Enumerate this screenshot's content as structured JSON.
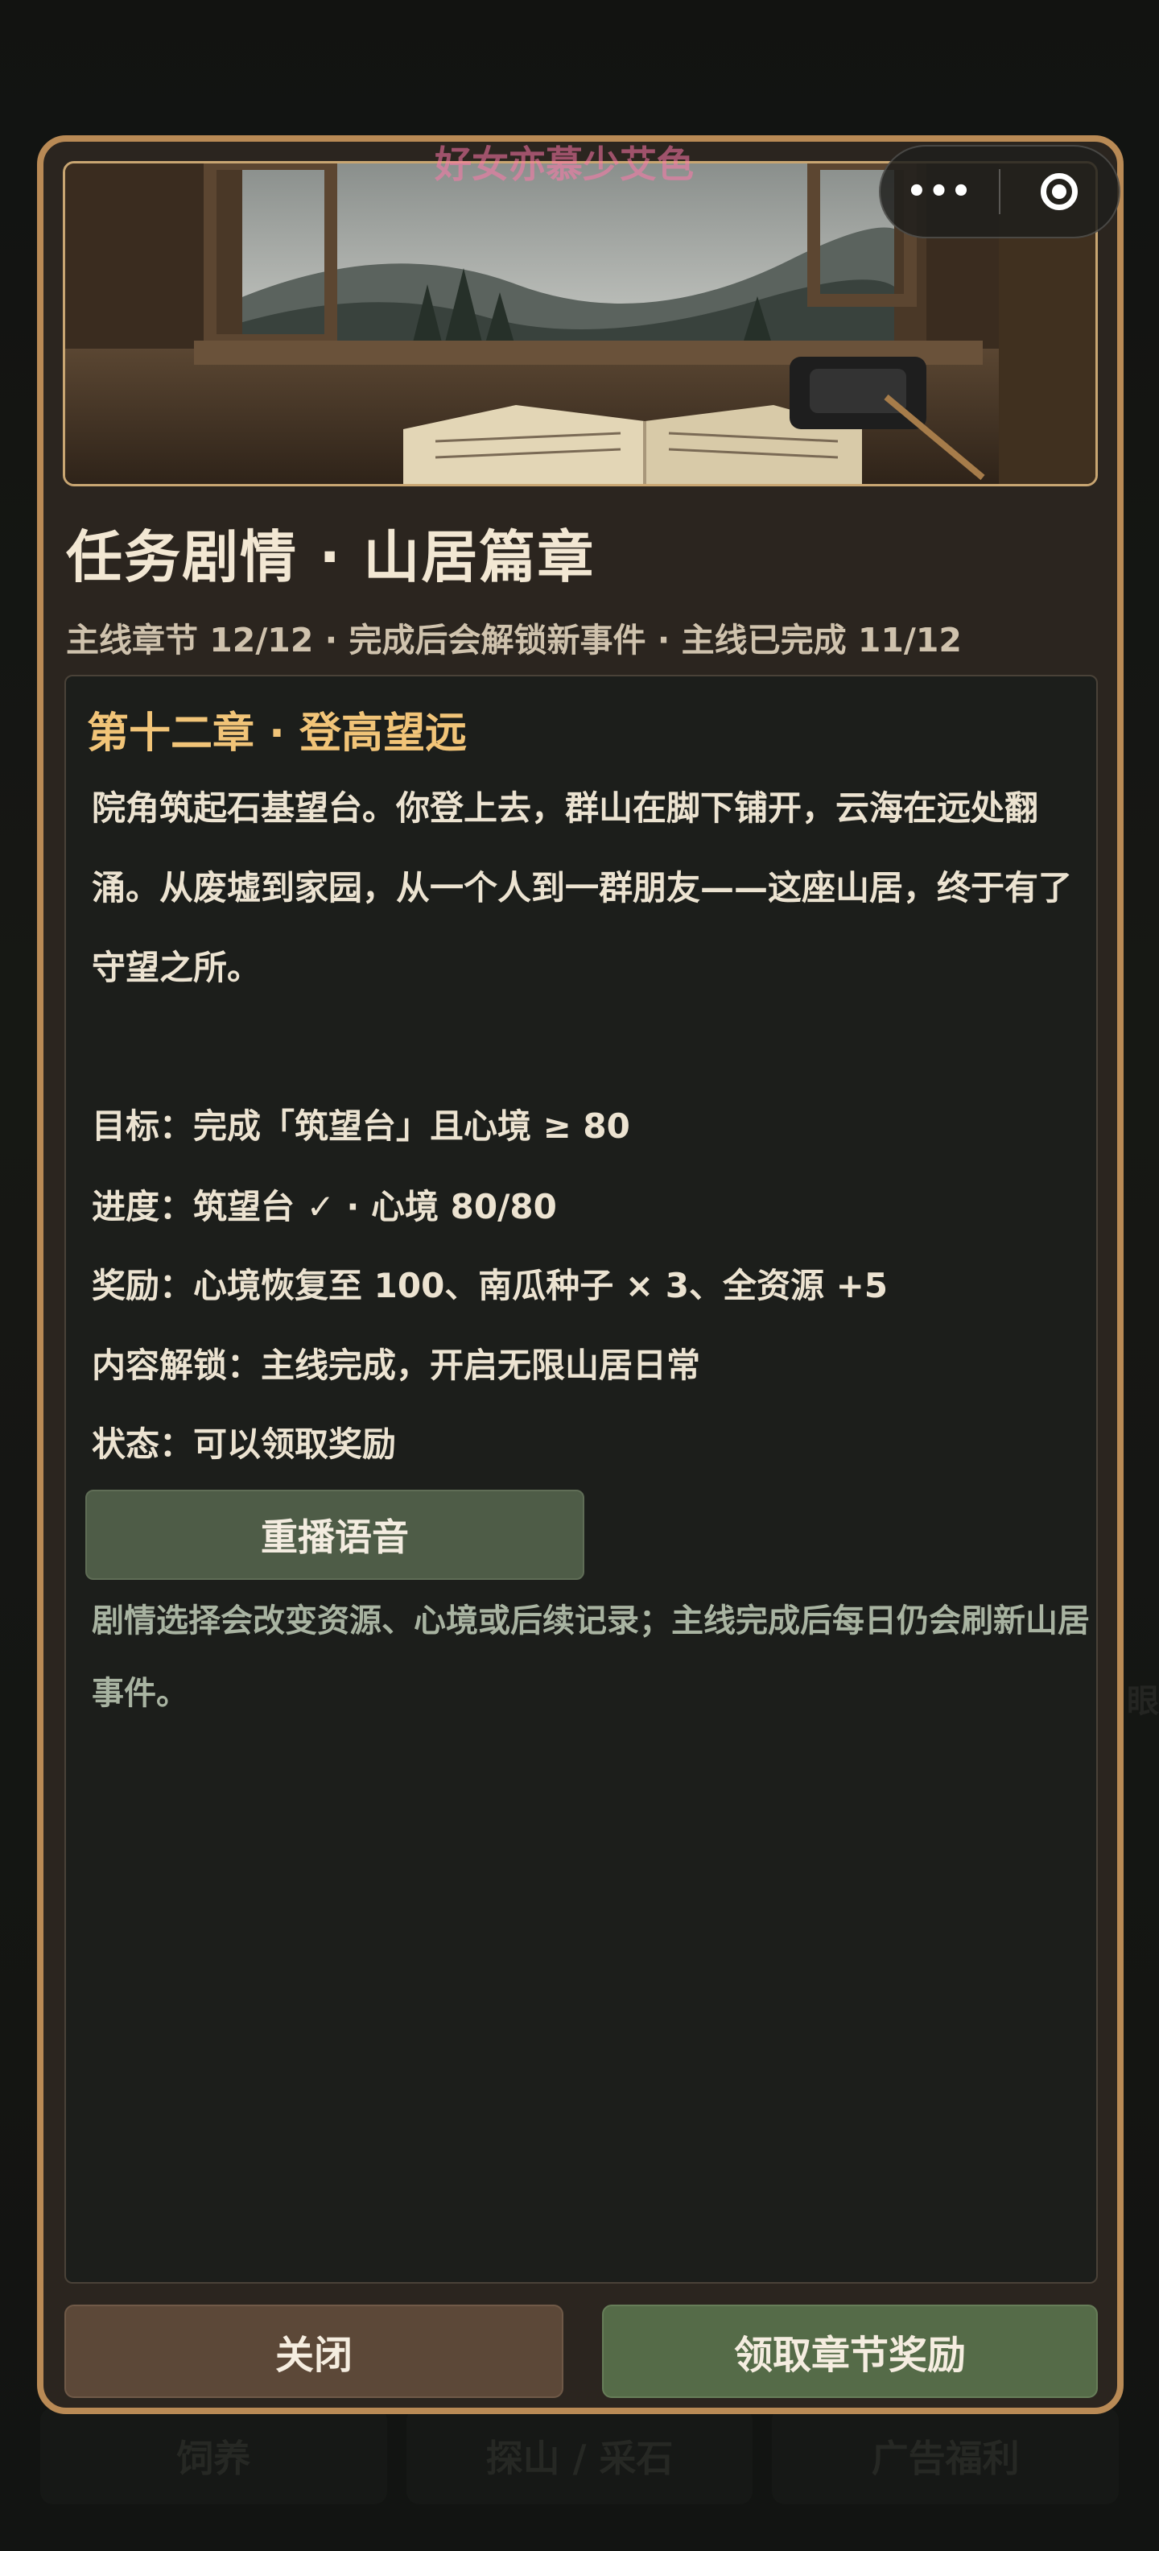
{
  "background": {
    "tabs": [
      "饲养",
      "探山 / 采石",
      "广告福利"
    ],
    "side_text": "眼"
  },
  "capsule": {
    "more_label": "•••"
  },
  "watermark": "好女亦慕少艾色",
  "modal": {
    "title": "任务剧情 · 山居篇章",
    "subtitle": "主线章节 12/12 · 完成后会解锁新事件 · 主线已完成 11/12",
    "chapter_title": "第十二章 · 登高望远",
    "story": "院角筑起石基望台。你登上去，群山在脚下铺开，云海在远处翻涌。从废墟到家园，从一个人到一群朋友——这座山居，终于有了守望之所。",
    "goal": "目标：完成「筑望台」且心境 ≥ 80",
    "progress": "进度：筑望台 ✓ · 心境 80/80",
    "reward": "奖励：心境恢复至 100、南瓜种子 × 3、全资源 +5",
    "unlock": "内容解锁：主线完成，开启无限山居日常",
    "status": "状态：可以领取奖励",
    "replay_label": "重播语音",
    "tip": "剧情选择会改变资源、心境或后续记录；主线完成后每日仍会刷新山居事件。",
    "close_label": "关闭",
    "claim_label": "领取章节奖励"
  },
  "colors": {
    "border": "#b98a55",
    "chapter": "#f1c478",
    "claim_button": "#556b48",
    "close_button": "#5c4838"
  }
}
